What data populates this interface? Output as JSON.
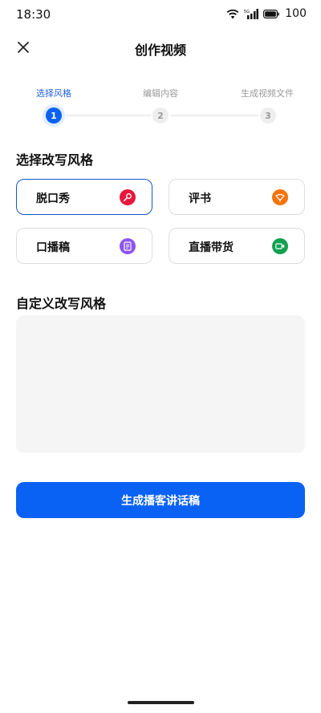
{
  "status_bar": {
    "time": "18:30",
    "network_label": "5G",
    "battery": "100"
  },
  "header": {
    "title": "创作视频",
    "close_icon": "close-icon"
  },
  "stepper": {
    "steps": [
      {
        "label": "选择风格",
        "number": "1",
        "active": true
      },
      {
        "label": "编辑内容",
        "number": "2",
        "active": false
      },
      {
        "label": "生成视频文件",
        "number": "3",
        "active": false
      }
    ]
  },
  "style_section": {
    "title": "选择改写风格",
    "options": [
      {
        "label": "脱口秀",
        "icon": "microphone-icon",
        "icon_color": "#e8173e",
        "selected": true
      },
      {
        "label": "评书",
        "icon": "fan-icon",
        "icon_color": "#f5740a",
        "selected": false
      },
      {
        "label": "口播稿",
        "icon": "document-icon",
        "icon_color": "#8b55f0",
        "selected": false
      },
      {
        "label": "直播带货",
        "icon": "video-camera-icon",
        "icon_color": "#12a150",
        "selected": false
      }
    ]
  },
  "custom_section": {
    "title": "自定义改写风格",
    "value": "",
    "placeholder": ""
  },
  "actions": {
    "generate_label": "生成播客讲话稿"
  },
  "colors": {
    "accent": "#0a62f5",
    "selected_border": "#1657c5",
    "inactive_step": "#eeeeee"
  }
}
